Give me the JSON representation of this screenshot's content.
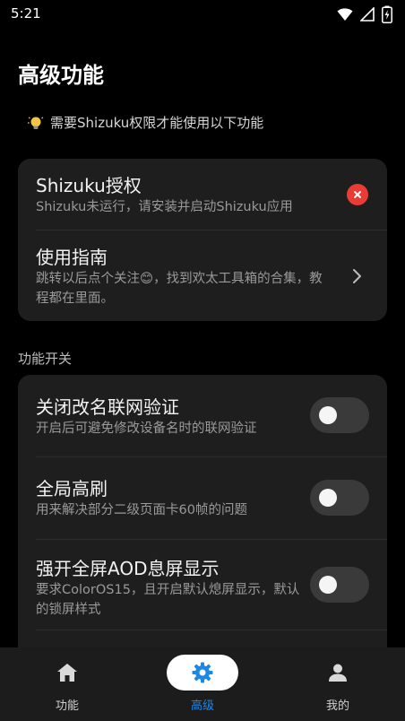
{
  "status_bar": {
    "time": "5:21"
  },
  "page": {
    "title": "高级功能"
  },
  "notice": {
    "text": "需要Shizuku权限才能使用以下功能"
  },
  "top_card": {
    "items": [
      {
        "title": "Shizuku授权",
        "subtitle": "Shizuku未运行，请安装并启动Shizuku应用",
        "status_icon": "error-x-icon"
      },
      {
        "title": "使用指南",
        "subtitle": "跳转以后点个关注😊，找到欢太工具箱的合集，教程都在里面。",
        "trailing_icon": "chevron-right-icon"
      }
    ]
  },
  "section": {
    "label": "功能开关"
  },
  "switch_card": {
    "items": [
      {
        "title": "关闭改名联网验证",
        "subtitle": "开启后可避免修改设备名时的联网验证",
        "enabled": false
      },
      {
        "title": "全局高刷",
        "subtitle": "用来解决部分二级页面卡60帧的问题",
        "enabled": false
      },
      {
        "title": "强开全屏AOD息屏显示",
        "subtitle": "要求ColorOS15，且开启默认熄屏显示，默认的锁屏样式",
        "enabled": false
      }
    ]
  },
  "bottom_nav": {
    "items": [
      {
        "label": "功能",
        "icon": "home-icon",
        "active": false
      },
      {
        "label": "高级",
        "icon": "gear-icon",
        "active": true
      },
      {
        "label": "我的",
        "icon": "person-icon",
        "active": false
      }
    ]
  },
  "colors": {
    "accent": "#1e88e5",
    "error": "#ea3b35",
    "card": "#1e1e1e"
  }
}
